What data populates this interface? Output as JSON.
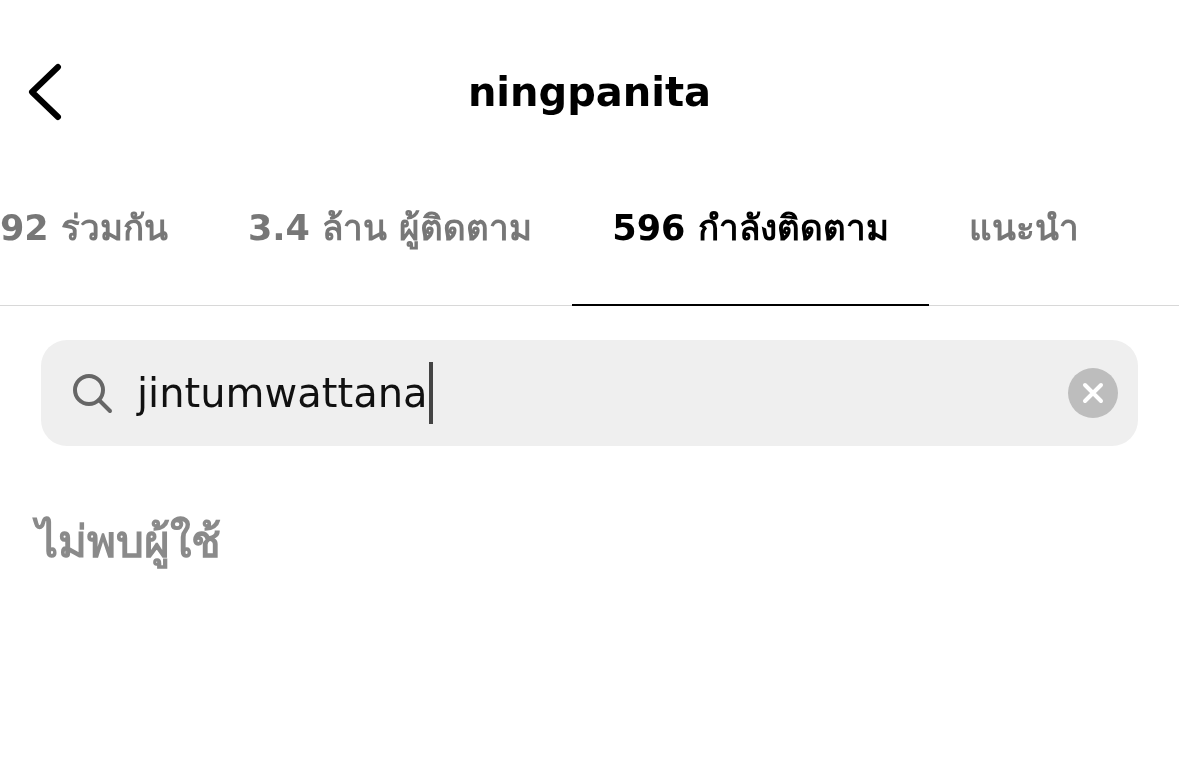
{
  "header": {
    "title": "ningpanita"
  },
  "tabs": [
    {
      "label": "92 ร่วมกัน",
      "selected": false
    },
    {
      "label": "3.4 ล้าน ผู้ติดตาม",
      "selected": false
    },
    {
      "label": "596 กำลังติดตาม",
      "selected": true
    },
    {
      "label": "แนะนำ",
      "selected": false
    }
  ],
  "search": {
    "value": "jintumwattana"
  },
  "message": "ไม่พบผู้ใช้"
}
